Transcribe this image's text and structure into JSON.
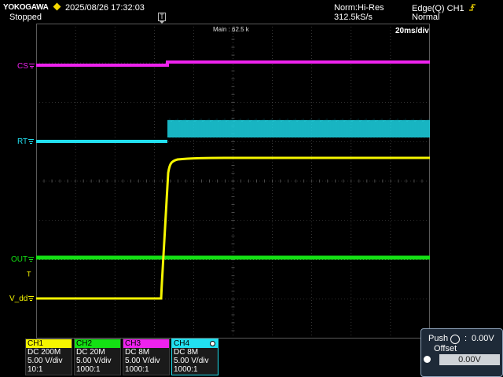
{
  "header": {
    "brand": "YOKOGAWA",
    "datetime": "2025/08/26 17:32:03",
    "status": "Stopped",
    "acq_mode": "Norm:Hi-Res",
    "sample_rate": "312.5kS/s",
    "trigger_type": "Edge(Q) CH1",
    "trigger_mode": "Normal",
    "trigger_marker": "T"
  },
  "plot": {
    "main_label": "Main : 62.5 k",
    "timebase": "20ms/div",
    "trigger_level_marker": "T",
    "channel_labels": [
      "CS",
      "RT",
      "OUT",
      "V_dd"
    ]
  },
  "channels": [
    {
      "name": "CH1",
      "color": "#f5f500",
      "coupling": "DC 200M",
      "scale": "5.00 V/div",
      "probe": "10:1"
    },
    {
      "name": "CH2",
      "color": "#14e014",
      "coupling": "DC 20M",
      "scale": "5.00 V/div",
      "probe": "1000:1"
    },
    {
      "name": "CH3",
      "color": "#ee22ee",
      "coupling": "DC 8M",
      "scale": "5.00 V/div",
      "probe": "1000:1"
    },
    {
      "name": "CH4",
      "color": "#22e0f0",
      "coupling": "DC 8M",
      "scale": "5.00 V/div",
      "probe": "1000:1"
    }
  ],
  "offset_panel": {
    "push_label": "Push",
    "colon": ":",
    "push_value": "0.00V",
    "offset_label": "Offset",
    "offset_value": "0.00V"
  },
  "colors": {
    "cs": "#ee22ee",
    "rt": "#22e0f0",
    "out": "#14e014",
    "vdd": "#f5f500",
    "grid": "#5a5a5a"
  }
}
